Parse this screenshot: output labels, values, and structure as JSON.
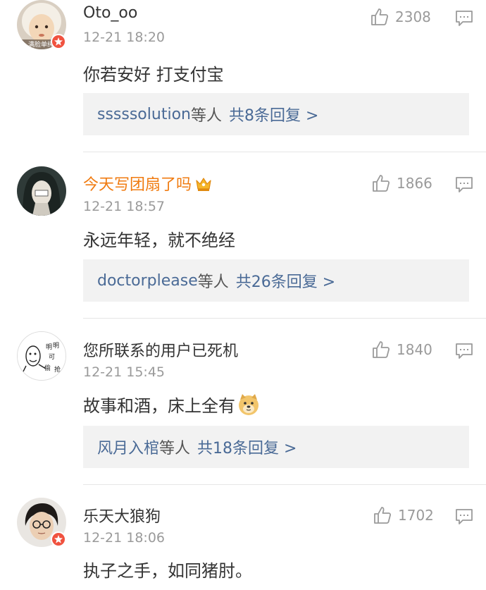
{
  "comments": [
    {
      "username": "Oto_oo",
      "time": "12-21 18:20",
      "text": "你若安好 打支付宝",
      "likes": "2308",
      "reply_users": "sssssolution",
      "reply_etc": "等人",
      "reply_count": "共8条回复 >",
      "avatar_label": "满脸单纯",
      "avatar_icon": "baby-avatar-icon",
      "verified_badge": true
    },
    {
      "username": "今天写团扇了吗",
      "time": "12-21 18:57",
      "text": "永远年轻，就不绝经",
      "likes": "1866",
      "reply_users": "doctorplease",
      "reply_etc": "等人",
      "reply_count": "共26条回复 >",
      "avatar_icon": "long-hair-avatar-icon",
      "vip_icon": "crown-icon",
      "name_color": "#f07b10"
    },
    {
      "username": "您所联系的用户已死机",
      "time": "12-21 15:45",
      "text": "故事和酒，床上全有",
      "likes": "1840",
      "reply_users": "风月入棺",
      "reply_etc": "等人",
      "reply_count": "共18条回复 >",
      "avatar_icon": "sketch-meme-avatar-icon",
      "emoji_icon": "doge-emoji-icon"
    },
    {
      "username": "乐天大狼狗",
      "time": "12-21 18:06",
      "text": "执子之手，如同猪肘。",
      "likes": "1702",
      "avatar_icon": "glasses-man-avatar-icon",
      "verified_badge": true
    }
  ],
  "colors": {
    "link": "#4a6a96",
    "meta": "#9a9a9a",
    "reply_bg": "#f2f2f2",
    "vip_name": "#f07b10",
    "badge": "#f0523f"
  }
}
